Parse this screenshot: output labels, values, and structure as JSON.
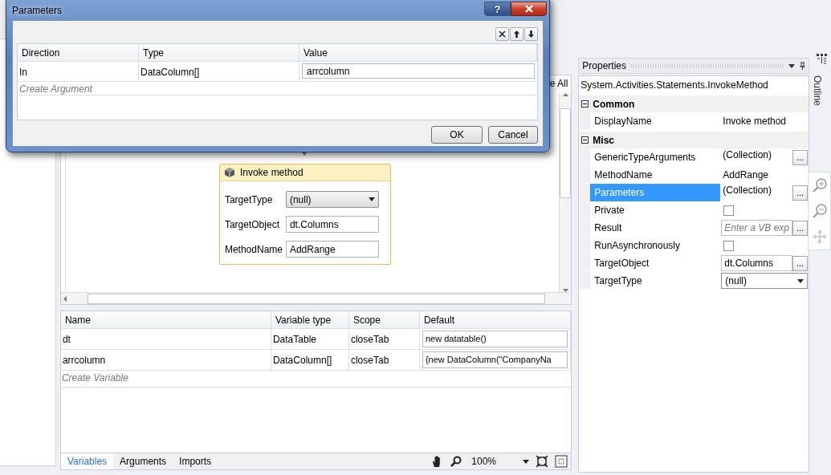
{
  "background": {
    "fragment": "e All"
  },
  "dialog": {
    "title": "Parameters",
    "help": "?",
    "columns": [
      "Direction",
      "Type",
      "Value"
    ],
    "rows": [
      {
        "direction": "In",
        "type": "DataColumn[]",
        "value": "arrcolumn"
      }
    ],
    "create_label": "Create Argument",
    "buttons": [
      "OK",
      "Cancel"
    ]
  },
  "activity": {
    "title": "Invoke method",
    "fields": [
      {
        "label": "TargetType",
        "value": "(null)",
        "kind": "dropdown"
      },
      {
        "label": "TargetObject",
        "value": "dt.Columns",
        "kind": "text"
      },
      {
        "label": "MethodName",
        "value": "AddRange",
        "kind": "text"
      }
    ]
  },
  "variables": {
    "columns": [
      "Name",
      "Variable type",
      "Scope",
      "Default"
    ],
    "rows": [
      {
        "name": "dt",
        "type": "DataTable",
        "scope": "closeTab",
        "default": "new datatable()"
      },
      {
        "name": "arrcolumn",
        "type": "DataColumn[]",
        "scope": "closeTab",
        "default": "{new DataColumn(\"CompanyNa"
      }
    ],
    "create_label": "Create Variable"
  },
  "bottom_bar": {
    "tabs": [
      {
        "label": "Variables",
        "selected": true
      },
      {
        "label": "Arguments",
        "selected": false
      },
      {
        "label": "Imports",
        "selected": false
      }
    ],
    "zoom": "100%"
  },
  "properties": {
    "title": "Properties",
    "type_name": "System.Activities.Statements.InvokeMethod",
    "categories": [
      {
        "name": "Common",
        "expanded": true,
        "items": [
          {
            "name": "DisplayName",
            "kind": "text",
            "value": "Invoke method",
            "selected": false
          }
        ]
      },
      {
        "name": "Misc",
        "expanded": true,
        "items": [
          {
            "name": "GenericTypeArguments",
            "kind": "collection",
            "value": "(Collection)",
            "button": "...",
            "selected": false
          },
          {
            "name": "MethodName",
            "kind": "text",
            "value": "AddRange",
            "selected": false
          },
          {
            "name": "Parameters",
            "kind": "collection",
            "value": "(Collection)",
            "button": "...",
            "selected": true
          },
          {
            "name": "Private",
            "kind": "checkbox",
            "checked": false,
            "selected": false
          },
          {
            "name": "Result",
            "kind": "expression",
            "placeholder": "Enter a VB exp",
            "button": "...",
            "selected": false
          },
          {
            "name": "RunAsynchronously",
            "kind": "checkbox",
            "checked": false,
            "selected": false
          },
          {
            "name": "TargetObject",
            "kind": "textbox",
            "value": "dt.Columns",
            "button": "...",
            "selected": false
          },
          {
            "name": "TargetType",
            "kind": "dropdown",
            "value": "(null)",
            "selected": false
          }
        ]
      }
    ]
  },
  "outline": {
    "label": "Outline"
  }
}
